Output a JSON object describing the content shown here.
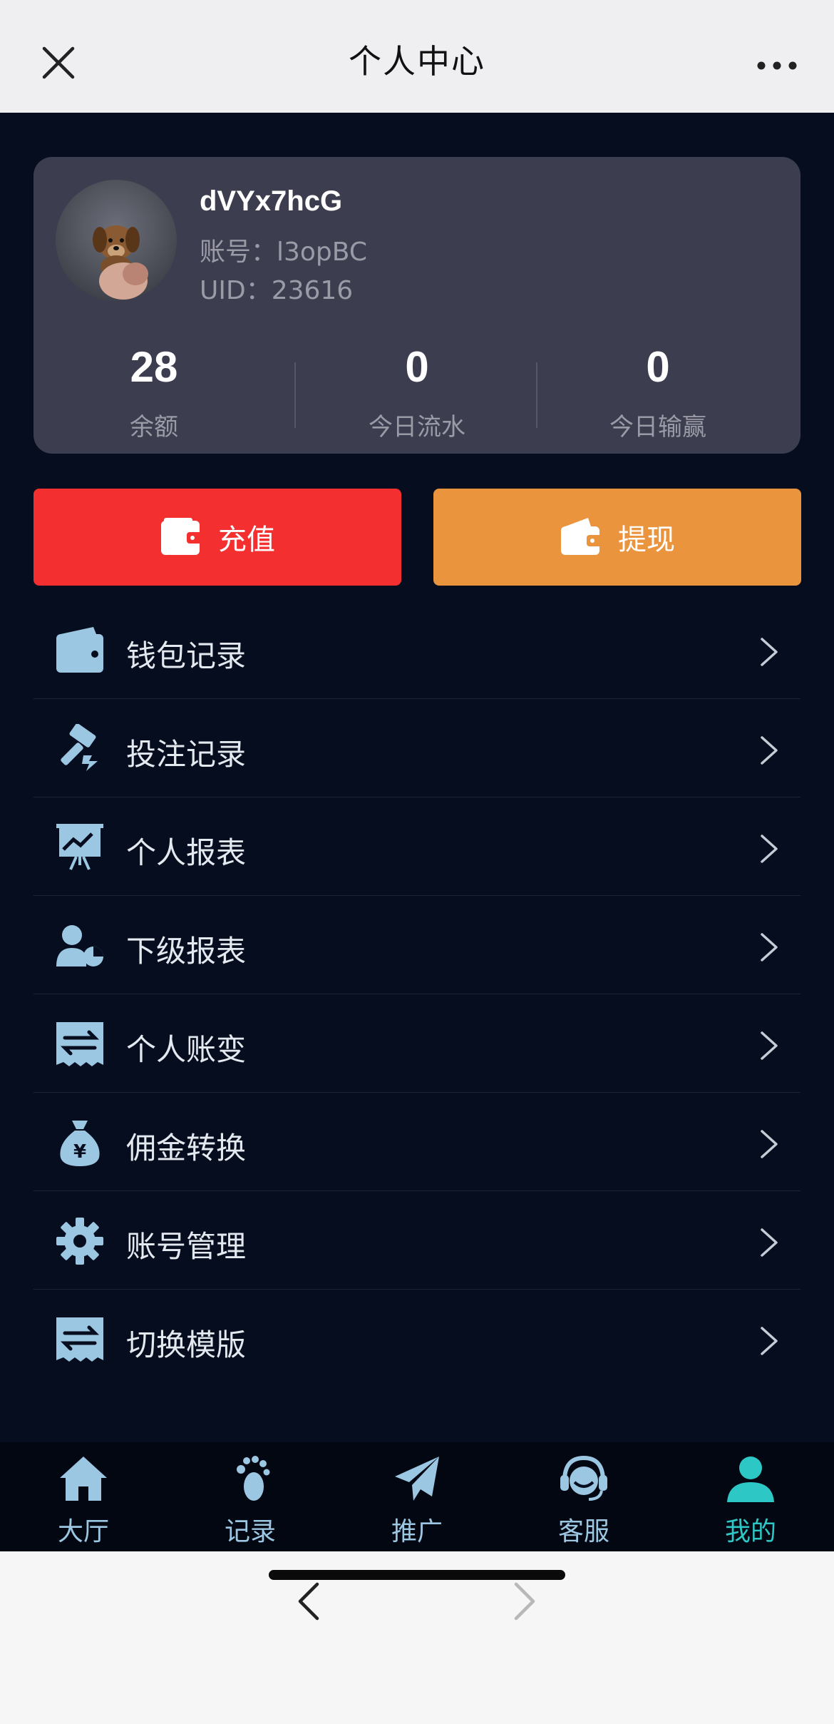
{
  "header": {
    "title": "个人中心",
    "close_icon": "close-icon",
    "more_icon": "more-dots-icon"
  },
  "profile": {
    "username": "dVYx7hcG",
    "account": "账号：l3opBC",
    "uid": "UID：23616",
    "stats": [
      {
        "value": "28",
        "label": "余额"
      },
      {
        "value": "0",
        "label": "今日流水"
      },
      {
        "value": "0",
        "label": "今日输赢"
      }
    ]
  },
  "actions": {
    "recharge": "充值",
    "withdraw": "提现"
  },
  "menu": [
    {
      "label": "钱包记录",
      "icon": "wallet-icon"
    },
    {
      "label": "投注记录",
      "icon": "gavel-icon"
    },
    {
      "label": "个人报表",
      "icon": "chart-board-icon"
    },
    {
      "label": "下级报表",
      "icon": "user-pie-icon"
    },
    {
      "label": "个人账变",
      "icon": "transfer-receipt-icon"
    },
    {
      "label": "佣金转换",
      "icon": "money-bag-icon"
    },
    {
      "label": "账号管理",
      "icon": "gear-icon"
    },
    {
      "label": "切换模版",
      "icon": "transfer-receipt-icon"
    }
  ],
  "tabs": [
    {
      "label": "大厅",
      "icon": "home-icon"
    },
    {
      "label": "记录",
      "icon": "footprints-icon"
    },
    {
      "label": "推广",
      "icon": "paper-plane-icon"
    },
    {
      "label": "客服",
      "icon": "headset-icon"
    },
    {
      "label": "我的",
      "icon": "user-icon"
    }
  ],
  "colors": {
    "accent": "#2dc7c5",
    "recharge": "#f42f2f",
    "withdraw": "#ea943e",
    "icon": "#9cc7e3"
  }
}
